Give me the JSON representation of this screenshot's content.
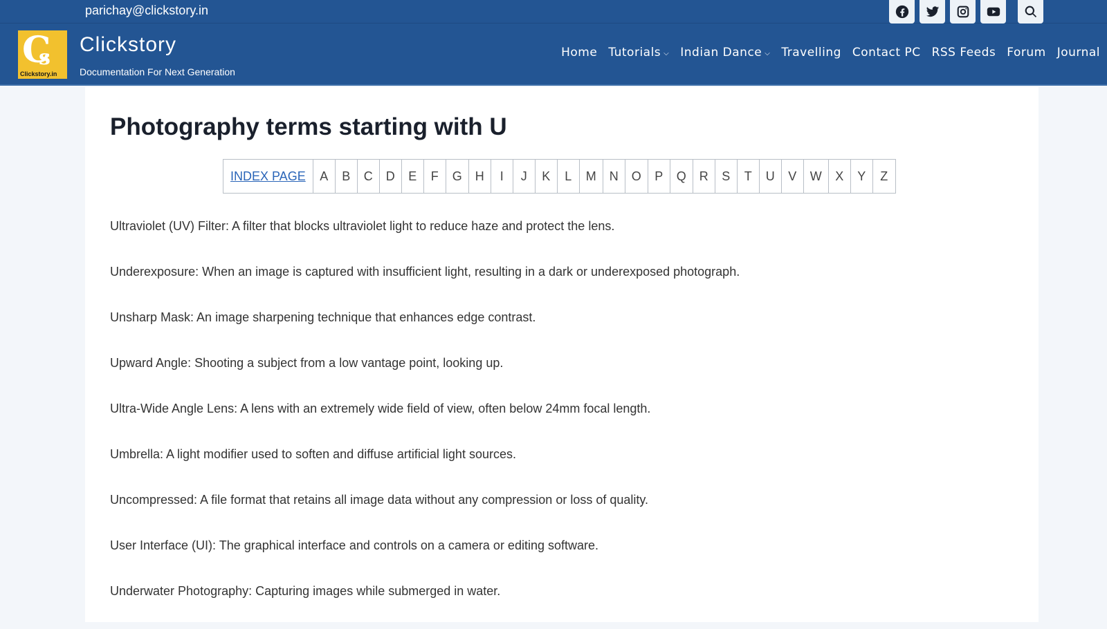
{
  "topbar": {
    "email": "parichay@clickstory.in",
    "social": [
      {
        "name": "facebook-icon"
      },
      {
        "name": "twitter-icon"
      },
      {
        "name": "instagram-icon"
      },
      {
        "name": "youtube-icon"
      },
      {
        "name": "search-icon"
      }
    ]
  },
  "header": {
    "logo_letters": "C",
    "logo_s": "s",
    "logo_tag": "Clickstory.in",
    "site_title": "Clickstory",
    "tagline": "Documentation For Next Generation",
    "nav": [
      {
        "label": "Home",
        "dropdown": false
      },
      {
        "label": "Tutorials",
        "dropdown": true
      },
      {
        "label": "Indian Dance",
        "dropdown": true
      },
      {
        "label": "Travelling",
        "dropdown": false
      },
      {
        "label": "Contact PC",
        "dropdown": false
      },
      {
        "label": "RSS Feeds",
        "dropdown": false
      },
      {
        "label": "Forum",
        "dropdown": false
      },
      {
        "label": "Journal",
        "dropdown": false
      }
    ],
    "chevron": "⌵"
  },
  "main": {
    "title": "Photography terms starting with U",
    "index_link": "INDEX PAGE",
    "letters": [
      "A",
      "B",
      "C",
      "D",
      "E",
      "F",
      "G",
      "H",
      "I",
      "J",
      "K",
      "L",
      "M",
      "N",
      "O",
      "P",
      "Q",
      "R",
      "S",
      "T",
      "U",
      "V",
      "W",
      "X",
      "Y",
      "Z"
    ],
    "terms": [
      "Ultraviolet (UV) Filter: A filter that blocks ultraviolet light to reduce haze and protect the lens.",
      "Underexposure: When an image is captured with insufficient light, resulting in a dark or underexposed photograph.",
      "Unsharp Mask: An image sharpening technique that enhances edge contrast.",
      "Upward Angle: Shooting a subject from a low vantage point, looking up.",
      "Ultra-Wide Angle Lens: A lens with an extremely wide field of view, often below 24mm focal length.",
      "Umbrella: A light modifier used to soften and diffuse artificial light sources.",
      "Uncompressed: A file format that retains all image data without any compression or loss of quality.",
      "User Interface (UI): The graphical interface and controls on a camera or editing software.",
      "Underwater Photography: Capturing images while submerged in water."
    ]
  }
}
